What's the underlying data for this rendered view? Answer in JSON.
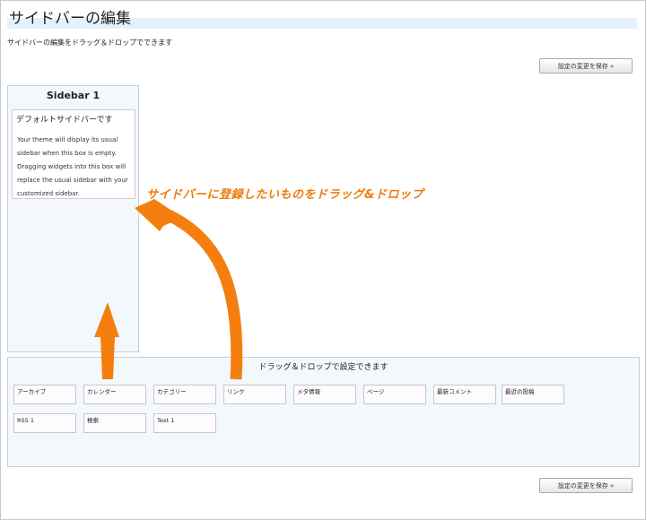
{
  "page": {
    "title": "サイドバーの編集",
    "description": "サイドバーの編集をドラッグ＆ドロップでできます"
  },
  "buttons": {
    "save_top": "設定の変更を保存 »",
    "save_bottom": "設定の変更を保存 »"
  },
  "sidebar": {
    "title": "Sidebar 1",
    "default_title": "デフォルトサイドバーです",
    "default_text": "Your theme will display its usual sidebar when this box is empty. Dragging widgets into this box will replace the usual sidebar with your customized sidebar."
  },
  "available": {
    "title": "ドラッグ＆ドロップで設定できます",
    "widgets": [
      "アーカイブ",
      "カレンダー",
      "カテゴリー",
      "リンク",
      "メタ情報",
      "ページ",
      "最新コメント",
      "最近の投稿",
      "RSS 1",
      "検索",
      "Text 1"
    ]
  },
  "annotation": {
    "text": "サイドバーに登録したいものをドラッグ&ドロップ",
    "color": "#f07a0c"
  },
  "colors": {
    "title_bar": "#e4f0fb",
    "panel_bg": "#f3f8fd",
    "arrow": "#f07a0c"
  }
}
